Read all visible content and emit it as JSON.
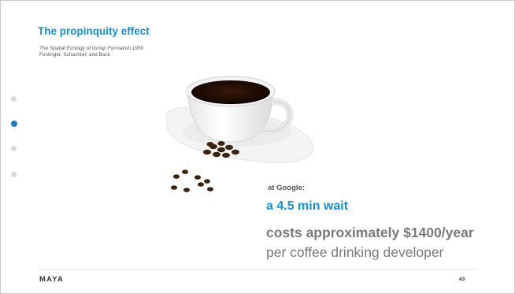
{
  "slide": {
    "title": "The propinquity effect",
    "reference_title": "The Spatial Ecology of Group Formation 1950",
    "reference_authors": "Festinger, Schachter, and Back",
    "label": "at Google:",
    "highlight": "a 4.5 min wait",
    "cost": "costs approximately $1400/year",
    "per": "per coffee drinking developer",
    "logo": "MAYA",
    "page_number": "43",
    "accent_color": "#1a8fc9"
  },
  "navigation": {
    "dots": [
      {
        "state": "inactive"
      },
      {
        "state": "active"
      },
      {
        "state": "inactive"
      },
      {
        "state": "inactive"
      }
    ]
  },
  "image": {
    "icon": "coffee-cup-icon"
  }
}
